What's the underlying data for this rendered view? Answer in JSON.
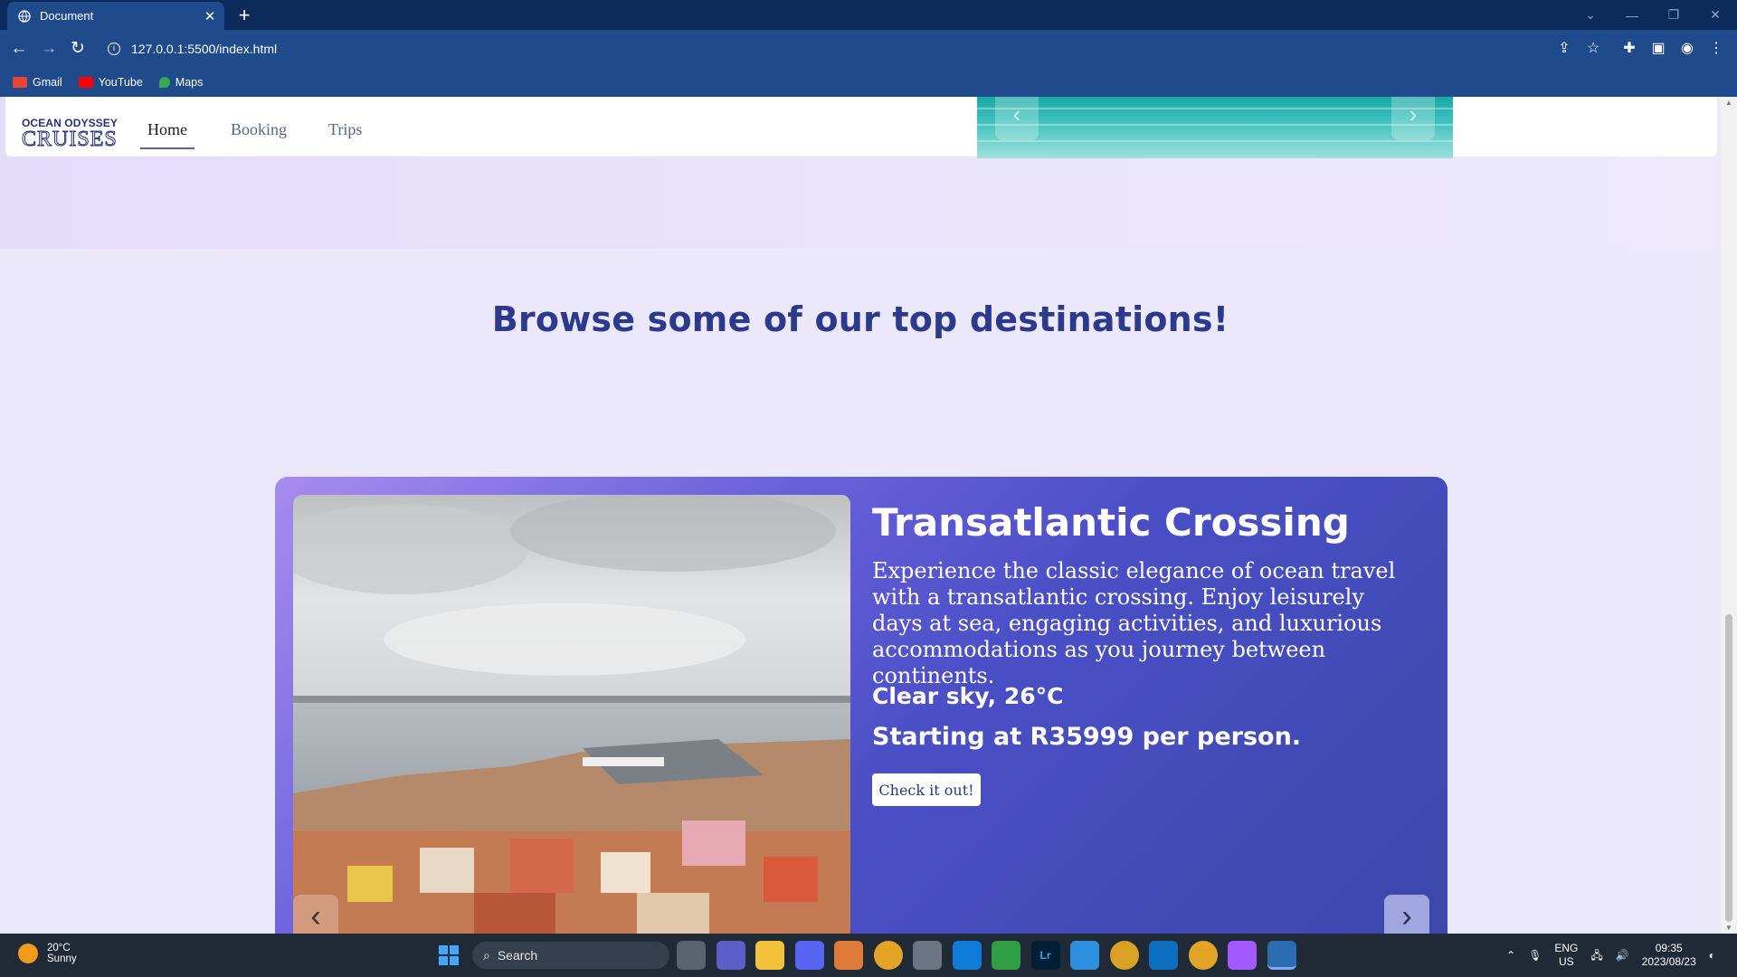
{
  "browser": {
    "tab_title": "Document",
    "tab_close": "✕",
    "new_tab": "+",
    "url": "127.0.0.1:5500/index.html",
    "bookmarks": [
      {
        "label": "Gmail",
        "color": "#ea4335"
      },
      {
        "label": "YouTube",
        "color": "#ff0000"
      },
      {
        "label": "Maps",
        "color": "#34a853"
      }
    ]
  },
  "site": {
    "logo_top": "OCEAN ODYSSEY",
    "logo_bottom": "CRUISES",
    "nav": [
      {
        "label": "Home",
        "active": true
      },
      {
        "label": "Booking",
        "active": false
      },
      {
        "label": "Trips",
        "active": false
      }
    ]
  },
  "section": {
    "heading": "Browse some of our top destinations!"
  },
  "destination": {
    "title": "Transatlantic Crossing",
    "description": "Experience the classic elegance of ocean travel with a transatlantic crossing. Enjoy leisurely days at sea, engaging activities, and luxurious accommodations as you journey between continents.",
    "weather": "Clear sky, 26°C",
    "price": "Starting at R35999 per person.",
    "cta": "Check it out!"
  },
  "taskbar": {
    "temp": "20°C",
    "condition": "Sunny",
    "search_placeholder": "Search",
    "lang1": "ENG",
    "lang2": "US",
    "time": "09:35",
    "date": "2023/08/23"
  },
  "colors": {
    "accent": "#2c3a8d",
    "card_start": "#a78cf0",
    "card_end": "#3b47a8"
  }
}
